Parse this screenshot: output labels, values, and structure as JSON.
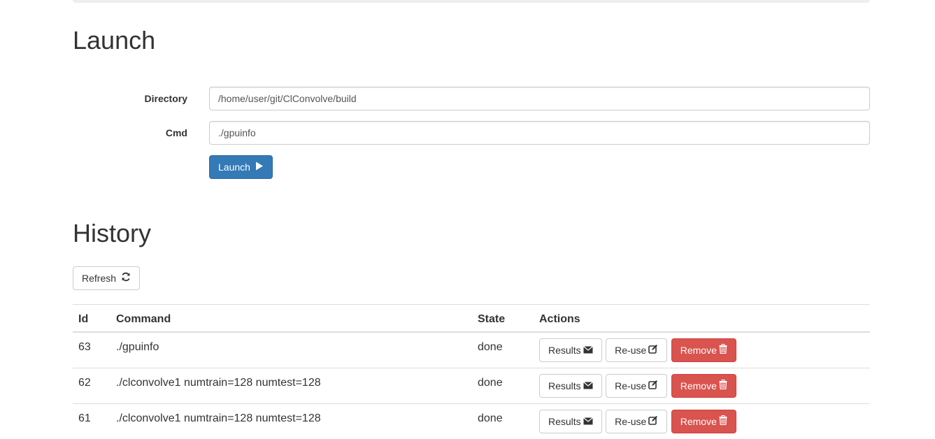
{
  "launch": {
    "title": "Launch",
    "directory_label": "Directory",
    "directory_value": "/home/user/git/ClConvolve/build",
    "cmd_label": "Cmd",
    "cmd_value": "./gpuinfo",
    "launch_button": "Launch"
  },
  "history": {
    "title": "History",
    "refresh_button": "Refresh",
    "columns": [
      "Id",
      "Command",
      "State",
      "Actions"
    ],
    "rows": [
      {
        "id": "63",
        "command": "./gpuinfo",
        "state": "done"
      },
      {
        "id": "62",
        "command": "./clconvolve1 numtrain=128 numtest=128",
        "state": "done"
      },
      {
        "id": "61",
        "command": "./clconvolve1 numtrain=128 numtest=128",
        "state": "done"
      }
    ],
    "action_labels": {
      "results": "Results",
      "reuse": "Re-use",
      "remove": "Remove"
    }
  },
  "icons": {
    "launch": "play-icon",
    "refresh": "refresh-icon",
    "results": "envelope-icon",
    "reuse": "edit-icon",
    "remove": "trash-icon"
  },
  "colors": {
    "primary": "#337ab7",
    "danger": "#d9534f"
  }
}
